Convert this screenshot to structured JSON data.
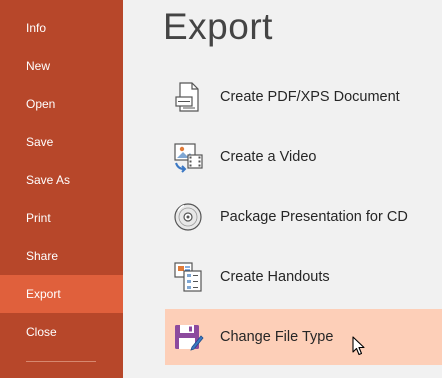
{
  "sidebar": {
    "items": [
      {
        "label": "Info"
      },
      {
        "label": "New"
      },
      {
        "label": "Open"
      },
      {
        "label": "Save"
      },
      {
        "label": "Save As"
      },
      {
        "label": "Print"
      },
      {
        "label": "Share"
      },
      {
        "label": "Export",
        "active": true
      },
      {
        "label": "Close"
      }
    ]
  },
  "main": {
    "title": "Export",
    "options": [
      {
        "label": "Create PDF/XPS Document",
        "icon": "pdf-document-icon"
      },
      {
        "label": "Create a Video",
        "icon": "video-icon"
      },
      {
        "label": "Package Presentation for CD",
        "icon": "cd-icon"
      },
      {
        "label": "Create Handouts",
        "icon": "handouts-icon"
      },
      {
        "label": "Change File Type",
        "icon": "save-file-type-icon",
        "selected": true
      }
    ]
  },
  "colors": {
    "sidebar_bg": "#b7472a",
    "sidebar_active": "#e0603c",
    "selected_option_bg": "#fdcfb8"
  }
}
